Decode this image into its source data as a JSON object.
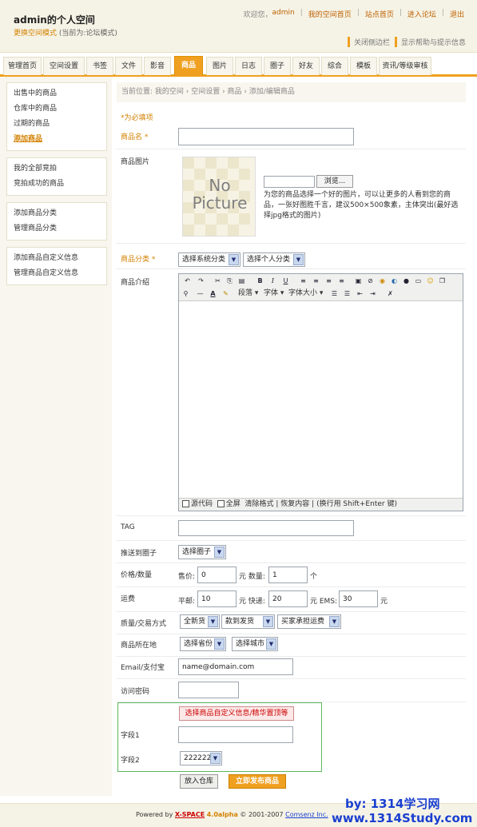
{
  "header": {
    "site_title": "admin的个人空间",
    "mode_link": "更换空间模式",
    "mode_current": "(当前为:论坛模式)",
    "welcome": "欢迎您，",
    "user": "admin",
    "links": [
      "我的空间首页",
      "站点首页",
      "进入论坛",
      "退出"
    ],
    "tool_close": "关闭侧边栏",
    "tool_help": "显示帮助与提示信息"
  },
  "nav": {
    "items": [
      "管理首页",
      "空间设置",
      "书签",
      "文件",
      "影音",
      "商品",
      "图片",
      "日志",
      "圈子",
      "好友",
      "综合",
      "模板",
      "资讯/等级审核"
    ],
    "active": "商品"
  },
  "sidebar": {
    "group1": [
      "出售中的商品",
      "仓库中的商品",
      "过期的商品",
      "添加商品"
    ],
    "group2": [
      "我的全部竞拍",
      "竞拍成功的商品"
    ],
    "group3": [
      "添加商品分类",
      "管理商品分类"
    ],
    "group4": [
      "添加商品自定义信息",
      "管理商品自定义信息"
    ]
  },
  "breadcrumb": "当前位置: 我的空间 › 空间设置 › 商品 › 添加/编辑商品",
  "required_note": "*为必填项",
  "form": {
    "name_label": "商品名 *",
    "image_label": "商品图片",
    "image_placeholder_text": "No Picture",
    "browse_button": "浏览...",
    "image_hint": "为您的商品选择一个好的图片，可以让更多的人看到您的商品，一张好图胜千言，建议500×500象素，主体突出(最好选择jpg格式的图片)",
    "category_label": "商品分类 *",
    "category_system": "选择系统分类",
    "category_personal": "选择个人分类",
    "intro_label": "商品介绍",
    "editor_para": "段落",
    "editor_font": "字体",
    "editor_size": "字体大小",
    "editor_source": "源代码",
    "editor_fullscreen": "全屏",
    "editor_clear": "清除格式",
    "editor_restore": "恢复内容",
    "editor_hint": "(换行用 Shift+Enter 键)",
    "tag_label": "TAG",
    "circle_label": "推送到圈子",
    "circle_select": "选择圈子",
    "price_label": "价格/数量",
    "price_prefix": "售价:",
    "price_value": "0",
    "price_unit": "元 数量:",
    "qty_value": "1",
    "qty_unit": "个",
    "shipping_label": "运费",
    "ship_post": "平邮:",
    "ship_post_value": "10",
    "ship_express": "元 快递:",
    "ship_express_value": "20",
    "ship_ems": "元 EMS:",
    "ship_ems_value": "30",
    "ship_unit": "元",
    "quality_label": "质量/交易方式",
    "quality_new": "全新货",
    "quality_pay": "款到发货",
    "quality_fee": "买家承担运费",
    "location_label": "商品所在地",
    "location_province": "选择省份",
    "location_city": "选择城市",
    "email_label": "Email/支付宝",
    "email_value": "name@domain.com",
    "password_label": "访问密码",
    "custom_button": "选择商品自定义信息/精华置顶等",
    "field1_label": "字段1",
    "field2_label": "字段2",
    "field2_value": "222222",
    "save_button": "放入仓库",
    "publish_button": "立即发布商品"
  },
  "footer": {
    "powered": "Powered by",
    "brand": "X-SPACE",
    "version": "4.0alpha",
    "copyright": "© 2001-2007",
    "company": "Comsenz Inc."
  },
  "watermark": {
    "line1": "by:  1314学习网",
    "line2": "www.1314Study.com"
  },
  "colors": {
    "accent": "#f0a020",
    "required": "#d38000",
    "watermark": "#1a3fd0"
  }
}
